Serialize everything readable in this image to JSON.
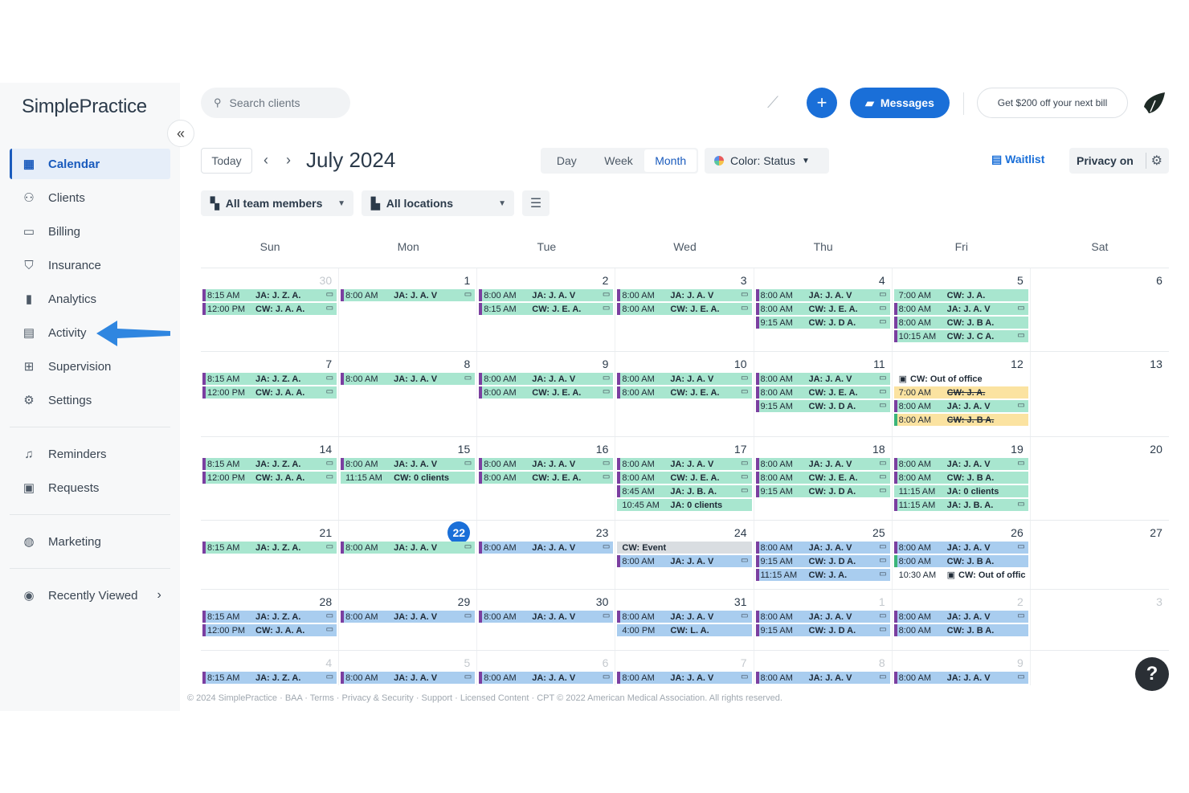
{
  "app": {
    "logo_text": "SimplePractice"
  },
  "sidebar": {
    "items": [
      {
        "label": "Calendar",
        "icon": "calendar-icon",
        "active": true
      },
      {
        "label": "Clients",
        "icon": "clients-icon"
      },
      {
        "label": "Billing",
        "icon": "billing-icon"
      },
      {
        "label": "Insurance",
        "icon": "shield-icon"
      },
      {
        "label": "Analytics",
        "icon": "bar-chart-icon"
      },
      {
        "label": "Activity",
        "icon": "activity-icon"
      },
      {
        "label": "Supervision",
        "icon": "supervision-icon"
      },
      {
        "label": "Settings",
        "icon": "gear-icon"
      }
    ],
    "items2": [
      {
        "label": "Reminders",
        "icon": "bell-icon"
      },
      {
        "label": "Requests",
        "icon": "calendar-request-icon"
      }
    ],
    "items3": [
      {
        "label": "Marketing",
        "icon": "globe-icon"
      }
    ],
    "recently_viewed": "Recently Viewed"
  },
  "header": {
    "search_placeholder": "Search clients",
    "messages_label": "Messages",
    "promo_label": "Get $200 off your next bill"
  },
  "toolbar": {
    "today": "Today",
    "month_title": "July 2024",
    "views": [
      "Day",
      "Week",
      "Month"
    ],
    "active_view": "Month",
    "color_label": "Color: Status",
    "waitlist": "Waitlist",
    "privacy": "Privacy on"
  },
  "filters": {
    "team": "All team members",
    "locations": "All locations"
  },
  "calendar": {
    "weekdays": [
      "Sun",
      "Mon",
      "Tue",
      "Wed",
      "Thu",
      "Fri",
      "Sat"
    ],
    "weeks": [
      [
        {
          "num": "30",
          "muted": true,
          "events": [
            {
              "time": "8:15 AM",
              "name": "JA: J. Z. A.",
              "color": "green",
              "video": true
            },
            {
              "time": "12:00 PM",
              "name": "CW: J. A. A.",
              "color": "green",
              "video": true
            }
          ]
        },
        {
          "num": "1",
          "events": [
            {
              "time": "8:00 AM",
              "name": "JA: J. A. V",
              "color": "green",
              "video": true
            }
          ]
        },
        {
          "num": "2",
          "events": [
            {
              "time": "8:00 AM",
              "name": "JA: J. A. V",
              "color": "green",
              "video": true
            },
            {
              "time": "8:15 AM",
              "name": "CW: J. E. A.",
              "color": "green",
              "video": true
            }
          ]
        },
        {
          "num": "3",
          "events": [
            {
              "time": "8:00 AM",
              "name": "JA: J. A. V",
              "color": "green",
              "video": true
            },
            {
              "time": "8:00 AM",
              "name": "CW: J. E. A.",
              "color": "green",
              "video": true
            }
          ]
        },
        {
          "num": "4",
          "events": [
            {
              "time": "8:00 AM",
              "name": "JA: J. A. V",
              "color": "green",
              "video": true
            },
            {
              "time": "8:00 AM",
              "name": "CW: J. E. A.",
              "color": "green",
              "video": true
            },
            {
              "time": "9:15 AM",
              "name": "CW: J. D A.",
              "color": "green",
              "video": true
            }
          ]
        },
        {
          "num": "5",
          "events": [
            {
              "time": "7:00 AM",
              "name": "CW: J. A.",
              "color": "green",
              "bar": "none"
            },
            {
              "time": "8:00 AM",
              "name": "JA: J. A. V",
              "color": "green",
              "video": true
            },
            {
              "time": "8:00 AM",
              "name": "CW: J. B A.",
              "color": "green"
            },
            {
              "time": "10:15 AM",
              "name": "CW: J. C A.",
              "color": "green",
              "video": true
            }
          ]
        },
        {
          "num": "6",
          "events": []
        }
      ],
      [
        {
          "num": "7",
          "events": [
            {
              "time": "8:15 AM",
              "name": "JA: J. Z. A.",
              "color": "green",
              "video": true
            },
            {
              "time": "12:00 PM",
              "name": "CW: J. A. A.",
              "color": "green",
              "video": true
            }
          ]
        },
        {
          "num": "8",
          "events": [
            {
              "time": "8:00 AM",
              "name": "JA: J. A. V",
              "color": "green",
              "video": true
            }
          ]
        },
        {
          "num": "9",
          "events": [
            {
              "time": "8:00 AM",
              "name": "JA: J. A. V",
              "color": "green",
              "video": true
            },
            {
              "time": "8:00 AM",
              "name": "CW: J. E. A.",
              "color": "green",
              "video": true
            }
          ]
        },
        {
          "num": "10",
          "events": [
            {
              "time": "8:00 AM",
              "name": "JA: J. A. V",
              "color": "green",
              "video": true
            },
            {
              "time": "8:00 AM",
              "name": "CW: J. E. A.",
              "color": "green",
              "video": true
            }
          ]
        },
        {
          "num": "11",
          "events": [
            {
              "time": "8:00 AM",
              "name": "JA: J. A. V",
              "color": "green",
              "video": true
            },
            {
              "time": "8:00 AM",
              "name": "CW: J. E. A.",
              "color": "green",
              "video": true
            },
            {
              "time": "9:15 AM",
              "name": "CW: J. D A.",
              "color": "green",
              "video": true
            }
          ]
        },
        {
          "num": "12",
          "events": [
            {
              "time": "",
              "name": "CW: Out of office",
              "color": "plain",
              "ooo": true
            },
            {
              "time": "7:00 AM",
              "name": "CW: J. A.",
              "color": "yellow",
              "bar": "none",
              "strike": true
            },
            {
              "time": "8:00 AM",
              "name": "JA: J. A. V",
              "color": "green",
              "video": true
            },
            {
              "time": "8:00 AM",
              "name": "CW: J. B A.",
              "color": "yellow",
              "bar": "green",
              "strike": true
            }
          ]
        },
        {
          "num": "13",
          "events": []
        }
      ],
      [
        {
          "num": "14",
          "events": [
            {
              "time": "8:15 AM",
              "name": "JA: J. Z. A.",
              "color": "green",
              "video": true
            },
            {
              "time": "12:00 PM",
              "name": "CW: J. A. A.",
              "color": "green",
              "video": true
            }
          ]
        },
        {
          "num": "15",
          "events": [
            {
              "time": "8:00 AM",
              "name": "JA: J. A. V",
              "color": "green",
              "video": true
            },
            {
              "time": "11:15 AM",
              "name": "CW: 0 clients",
              "color": "green",
              "bar": "none"
            }
          ]
        },
        {
          "num": "16",
          "events": [
            {
              "time": "8:00 AM",
              "name": "JA: J. A. V",
              "color": "green",
              "video": true
            },
            {
              "time": "8:00 AM",
              "name": "CW: J. E. A.",
              "color": "green",
              "video": true
            }
          ]
        },
        {
          "num": "17",
          "events": [
            {
              "time": "8:00 AM",
              "name": "JA: J. A. V",
              "color": "green",
              "video": true
            },
            {
              "time": "8:00 AM",
              "name": "CW: J. E. A.",
              "color": "green",
              "video": true
            },
            {
              "time": "8:45 AM",
              "name": "JA: J. B. A.",
              "color": "green",
              "video": true
            },
            {
              "time": "10:45 AM",
              "name": "JA: 0 clients",
              "color": "green",
              "bar": "none"
            }
          ]
        },
        {
          "num": "18",
          "events": [
            {
              "time": "8:00 AM",
              "name": "JA: J. A. V",
              "color": "green",
              "video": true
            },
            {
              "time": "8:00 AM",
              "name": "CW: J. E. A.",
              "color": "green",
              "video": true
            },
            {
              "time": "9:15 AM",
              "name": "CW: J. D A.",
              "color": "green",
              "video": true
            }
          ]
        },
        {
          "num": "19",
          "events": [
            {
              "time": "8:00 AM",
              "name": "JA: J. A. V",
              "color": "green",
              "video": true
            },
            {
              "time": "8:00 AM",
              "name": "CW: J. B A.",
              "color": "green"
            },
            {
              "time": "11:15 AM",
              "name": "JA: 0 clients",
              "color": "green",
              "bar": "none"
            },
            {
              "time": "11:15 AM",
              "name": "JA: J. B. A.",
              "color": "green",
              "video": true
            }
          ]
        },
        {
          "num": "20",
          "events": []
        }
      ],
      [
        {
          "num": "21",
          "events": [
            {
              "time": "8:15 AM",
              "name": "JA: J. Z. A.",
              "color": "green",
              "video": true
            }
          ]
        },
        {
          "num": "22",
          "today": true,
          "events": [
            {
              "time": "8:00 AM",
              "name": "JA: J. A. V",
              "color": "green",
              "video": true
            }
          ]
        },
        {
          "num": "23",
          "events": [
            {
              "time": "8:00 AM",
              "name": "JA: J. A. V",
              "color": "blue",
              "video": true
            }
          ]
        },
        {
          "num": "24",
          "events": [
            {
              "time": "",
              "name": "CW: Event",
              "color": "gray"
            },
            {
              "time": "8:00 AM",
              "name": "JA: J. A. V",
              "color": "blue",
              "video": true
            }
          ]
        },
        {
          "num": "25",
          "events": [
            {
              "time": "8:00 AM",
              "name": "JA: J. A. V",
              "color": "blue",
              "video": true
            },
            {
              "time": "9:15 AM",
              "name": "CW: J. D A.",
              "color": "blue",
              "video": true
            },
            {
              "time": "11:15 AM",
              "name": "CW: J. A.",
              "color": "blue",
              "video": true
            }
          ]
        },
        {
          "num": "26",
          "events": [
            {
              "time": "8:00 AM",
              "name": "JA: J. A. V",
              "color": "blue",
              "video": true
            },
            {
              "time": "8:00 AM",
              "name": "CW: J. B A.",
              "color": "blue",
              "bar": "green"
            },
            {
              "time": "10:30 AM",
              "name": "CW: Out of offic",
              "color": "plain",
              "ooo": true
            }
          ]
        },
        {
          "num": "27",
          "events": []
        }
      ],
      [
        {
          "num": "28",
          "events": [
            {
              "time": "8:15 AM",
              "name": "JA: J. Z. A.",
              "color": "blue",
              "video": true
            },
            {
              "time": "12:00 PM",
              "name": "CW: J. A. A.",
              "color": "blue",
              "video": true
            }
          ]
        },
        {
          "num": "29",
          "events": [
            {
              "time": "8:00 AM",
              "name": "JA: J. A. V",
              "color": "blue",
              "video": true
            }
          ]
        },
        {
          "num": "30",
          "events": [
            {
              "time": "8:00 AM",
              "name": "JA: J. A. V",
              "color": "blue",
              "video": true
            }
          ]
        },
        {
          "num": "31",
          "events": [
            {
              "time": "8:00 AM",
              "name": "JA: J. A. V",
              "color": "blue",
              "video": true
            },
            {
              "time": "4:00 PM",
              "name": "CW: L. A.",
              "color": "blue",
              "bar": "none"
            }
          ]
        },
        {
          "num": "1",
          "muted": true,
          "events": [
            {
              "time": "8:00 AM",
              "name": "JA: J. A. V",
              "color": "blue",
              "video": true
            },
            {
              "time": "9:15 AM",
              "name": "CW: J. D A.",
              "color": "blue",
              "video": true
            }
          ]
        },
        {
          "num": "2",
          "muted": true,
          "events": [
            {
              "time": "8:00 AM",
              "name": "JA: J. A. V",
              "color": "blue",
              "video": true
            },
            {
              "time": "8:00 AM",
              "name": "CW: J. B A.",
              "color": "blue"
            }
          ]
        },
        {
          "num": "3",
          "muted": true,
          "events": []
        }
      ],
      [
        {
          "num": "4",
          "muted": true,
          "events": [
            {
              "time": "8:15 AM",
              "name": "JA: J. Z. A.",
              "color": "blue",
              "video": true
            }
          ]
        },
        {
          "num": "5",
          "muted": true,
          "events": [
            {
              "time": "8:00 AM",
              "name": "JA: J. A. V",
              "color": "blue",
              "video": true
            }
          ]
        },
        {
          "num": "6",
          "muted": true,
          "events": [
            {
              "time": "8:00 AM",
              "name": "JA: J. A. V",
              "color": "blue",
              "video": true
            }
          ]
        },
        {
          "num": "7",
          "muted": true,
          "events": [
            {
              "time": "8:00 AM",
              "name": "JA: J. A. V",
              "color": "blue",
              "video": true
            }
          ]
        },
        {
          "num": "8",
          "muted": true,
          "events": [
            {
              "time": "8:00 AM",
              "name": "JA: J. A. V",
              "color": "blue",
              "video": true
            }
          ]
        },
        {
          "num": "9",
          "muted": true,
          "events": [
            {
              "time": "8:00 AM",
              "name": "JA: J. A. V",
              "color": "blue",
              "video": true
            }
          ]
        },
        {
          "num": "",
          "muted": true,
          "events": []
        }
      ]
    ]
  },
  "footer": "© 2024 SimplePractice · BAA · Terms · Privacy & Security · Support · Licensed Content · CPT © 2022 American Medical Association. All rights reserved.",
  "colors": {
    "accent": "#1a6fd8",
    "scheduled": "#a8e6cf",
    "upcoming": "#a9cdef",
    "canceled": "#fbe3a1",
    "bar": "#7b3fa0"
  }
}
